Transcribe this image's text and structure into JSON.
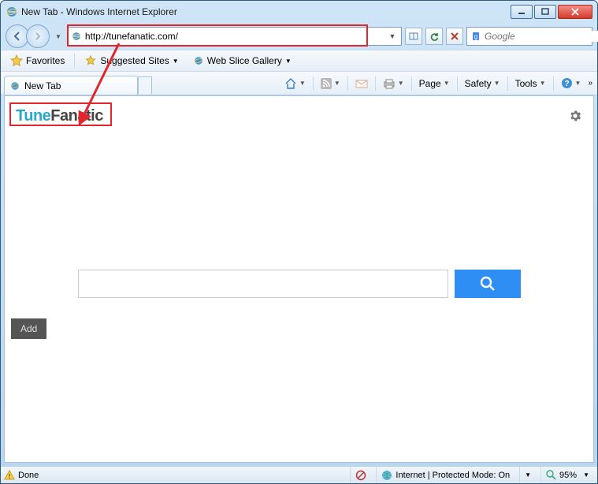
{
  "window": {
    "title": "New Tab - Windows Internet Explorer"
  },
  "nav": {
    "address": "http://tunefanatic.com/",
    "search_placeholder": "Google"
  },
  "favorites": {
    "button": "Favorites",
    "suggested": "Suggested Sites",
    "webslice": "Web Slice Gallery"
  },
  "tab": {
    "label": "New Tab"
  },
  "commands": {
    "page": "Page",
    "safety": "Safety",
    "tools": "Tools"
  },
  "page": {
    "logo_tune": "Tune",
    "logo_fanatic": "Fanatic",
    "add": "Add"
  },
  "status": {
    "done": "Done",
    "zone": "Internet | Protected Mode: On",
    "zoom": "95%"
  },
  "colors": {
    "annotation": "#e1272d",
    "search_button": "#2f8ef4",
    "logo_accent": "#2aa8c9"
  }
}
